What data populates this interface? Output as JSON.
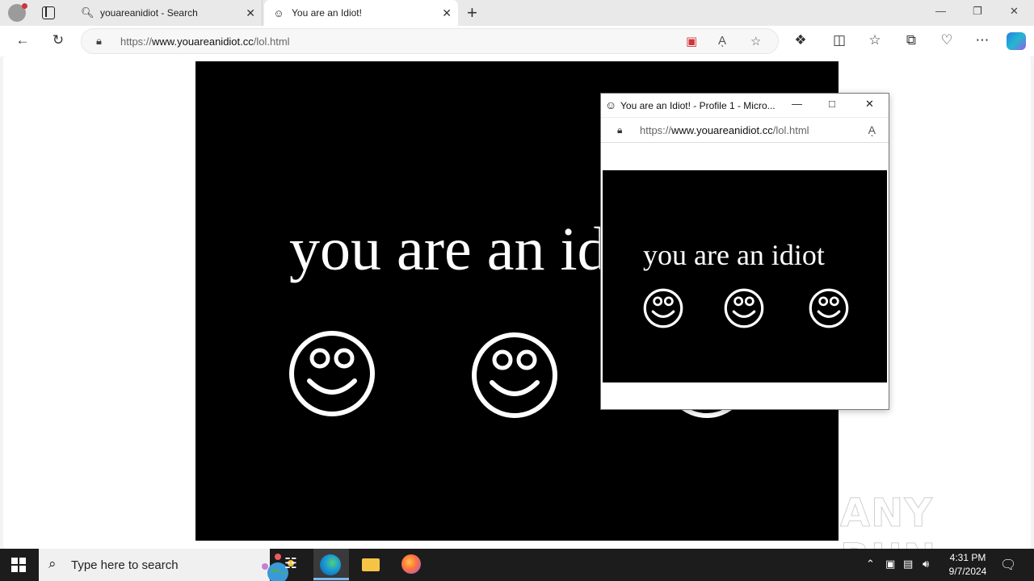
{
  "tabs": [
    {
      "title": "youareanidiot - Search",
      "icon": "search-icon"
    },
    {
      "title": "You are an Idiot!",
      "icon": "smiley-icon"
    }
  ],
  "address": {
    "prefix": "https://",
    "host": "www.youareanidiot.cc",
    "path": "/lol.html"
  },
  "page": {
    "heading": "you are an idiot"
  },
  "popup": {
    "title": "You are an Idiot! - Profile 1 - Micro...",
    "address_prefix": "https://",
    "address_host": "www.youareanidiot.cc",
    "address_path": "/lol.html",
    "heading": "you are an idiot"
  },
  "taskbar": {
    "search_placeholder": "Type here to search",
    "time": "4:31 PM",
    "date": "9/7/2024"
  },
  "watermark": "ANY RUN"
}
